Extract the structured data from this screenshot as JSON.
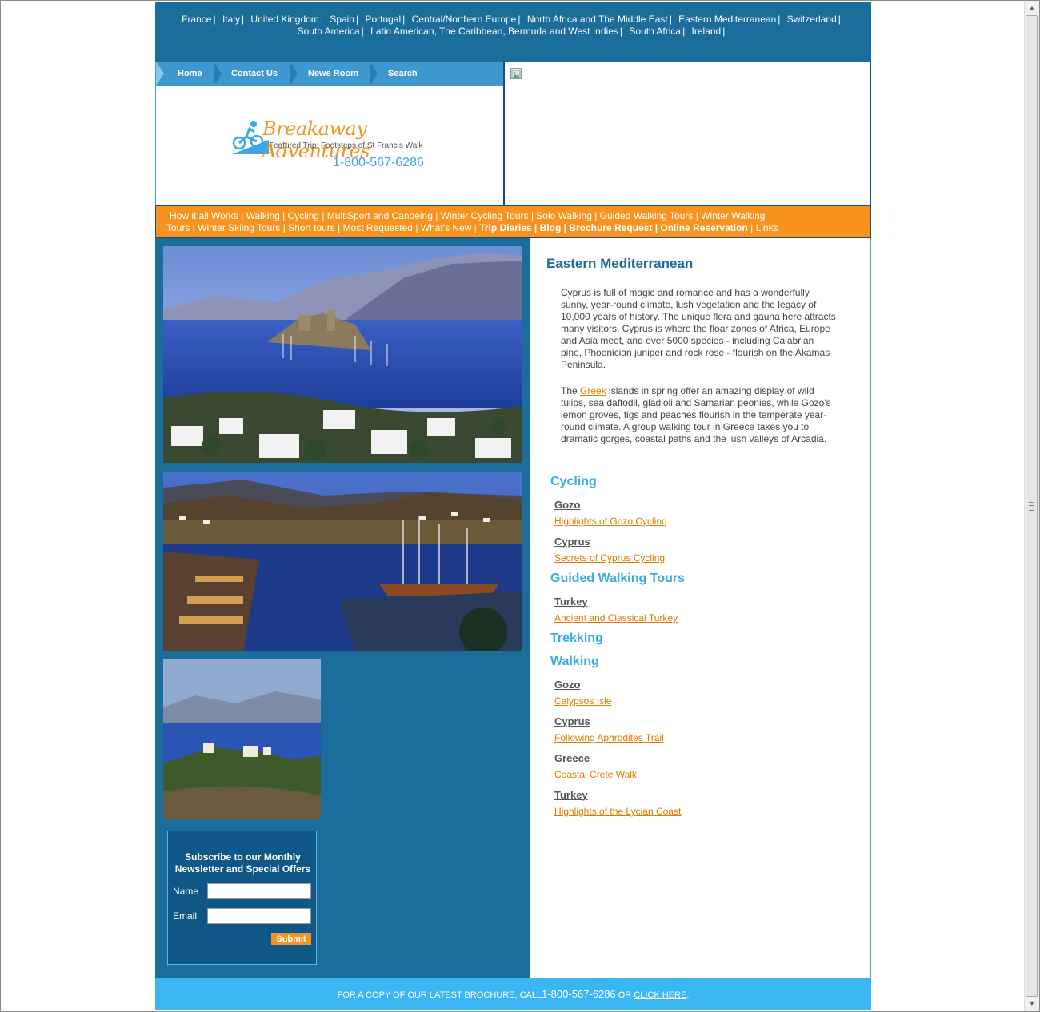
{
  "countries": [
    [
      "France",
      "Italy",
      "United Kingdom",
      "Spain",
      "Portugal",
      "Central/Northern Europe",
      "North Africa and The Middle East",
      "Eastern Mediterranean",
      "Switzerland"
    ],
    [
      "South America",
      "Latin American, The Caribbean, Bermuda and West Indies",
      "South Africa",
      "Ireland"
    ]
  ],
  "nav": {
    "home": "Home",
    "contact": "Contact Us",
    "news": "News Room",
    "search": "Search"
  },
  "logo": {
    "title": "Breakaway Adventures",
    "featured": "Featured Trip: Footsteps of St Francis Walk",
    "phone": "1-800-567-6286"
  },
  "menu": {
    "line1": [
      "How it all Works",
      "Walking",
      "Cycling",
      "MultiSport and Canoeing",
      "Winter Cycling Tours",
      "Solo Walking",
      "Guided Walking Tours",
      "Winter Walking"
    ],
    "line2_plain": [
      "Tours",
      "Winter Skiing Tours",
      "Short tours",
      "Most Requested",
      "What's New"
    ],
    "line2_bold": [
      "Trip Diaries",
      "Blog",
      "Brochure Request",
      "Online Reservation"
    ],
    "links": "Links"
  },
  "subscribe": {
    "title": "Subscribe to our Monthly Newsletter and Special Offers",
    "name_label": "Name",
    "email_label": "Email",
    "submit": "Submit"
  },
  "content": {
    "title": "Eastern Mediterranean",
    "para1": "Cyprus is full of magic and romance and has a wonderfully sunny, year-round climate, lush vegetation and the legacy of 10,000 years of history.   The unique flora and gauna here attracts many visitors.  Cyprus is where the floar zones of Africa, Europe and Asia meet, and over 5000 species - including Calabrian pine, Phoenician juniper and rock rose - flourish on the Akamas Peninsula.",
    "para2_before": "The ",
    "para2_link": "Greek",
    "para2_after": " islands in spring offer an amazing display of wild tulips, sea daffodil, gladioli and Samarian peonies, while Gozo's lemon groves, figs and peaches flourish in the temperate year-round climate.  A group walking tour in Greece takes you to dramatic gorges, coastal paths and the lush valleys of Arcadia.",
    "cycling": "Cycling",
    "cycling_gozo": "Gozo",
    "cycling_gozo_trip": "Highlights of Gozo Cycling",
    "cycling_cyprus": "Cyprus",
    "cycling_cyprus_trip": "Secrets of Cyprus Cycling",
    "guided": "Guided Walking Tours",
    "guided_turkey": "Turkey",
    "guided_turkey_trip": "Ancient and Classical Turkey",
    "trekking": "Trekking",
    "walking": "Walking",
    "walking_gozo": "Gozo",
    "walking_gozo_trip": "Calypsos Isle",
    "walking_cyprus": "Cyprus",
    "walking_cyprus_trip": "Following Aphrodites Trail",
    "walking_greece": "Greece",
    "walking_greece_trip": "Coastal Crete Walk",
    "walking_turkey": "Turkey",
    "walking_turkey_trip": "Highlights of the Lycian Coast"
  },
  "footer": {
    "text": "FOR A COPY OF OUR LATEST BROCHURE, CALL",
    "phone": "1-800-567-6286",
    "or": " OR ",
    "link": "CLICK HERE",
    "end": "."
  },
  "colors": {
    "blue": "#1b6d9c",
    "orange": "#f7931e",
    "light_blue": "#3ab6f2"
  }
}
